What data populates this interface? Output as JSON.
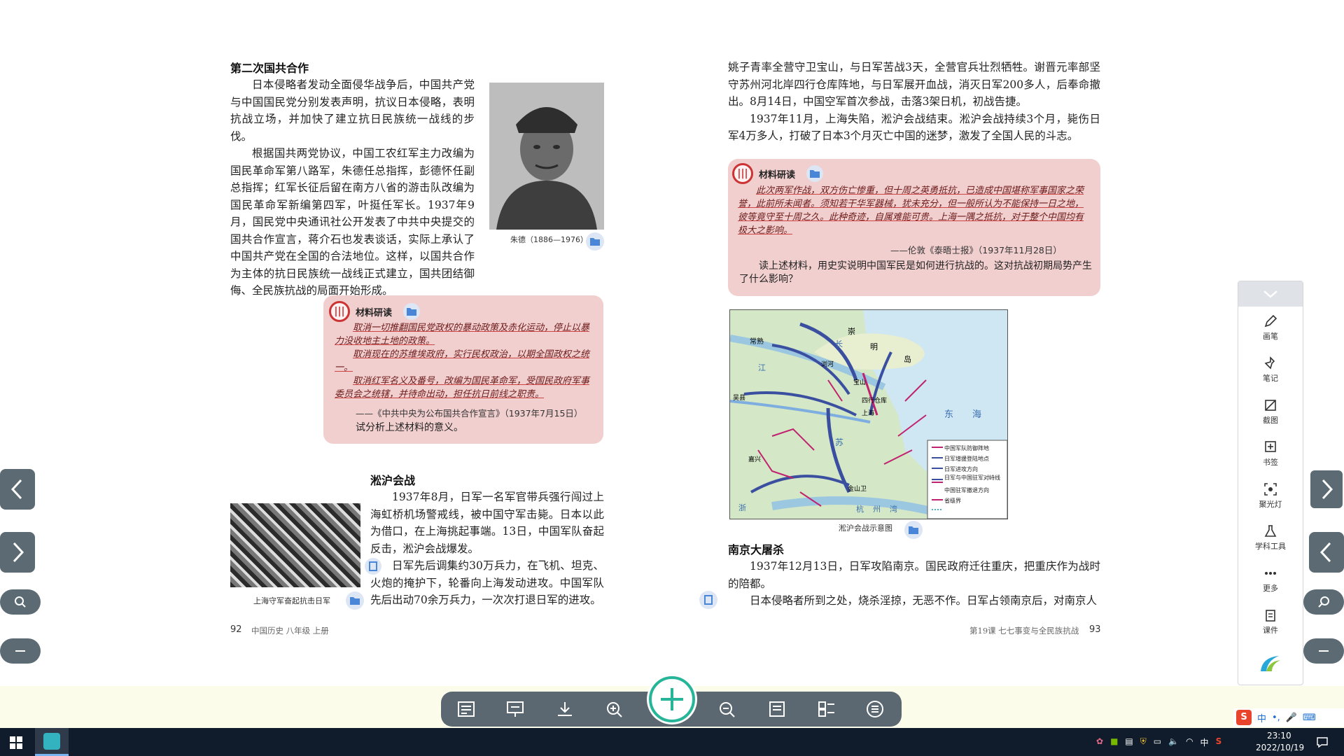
{
  "left_page": {
    "section1_title": "第二次国共合作",
    "para1": "日本侵略者发动全面侵华战争后，中国共产党与中国国民党分别发表声明，抗议日本侵略，表明抗战立场，并加快了建立抗日民族统一战线的步伐。",
    "para2": "根据国共两党协议，中国工农红军主力改编为国民革命军第八路军，朱德任总指挥，彭德怀任副总指挥；红军长征后留在南方八省的游击队改编为国民革命军新编第四军，叶挺任军长。1937年9月，国民党中央通讯社公开发表了中共中央提交的国共合作宣言，蒋介石也发表谈话，实际上承认了中国共产党在全国的合法地位。这样，以国共合作为主体的抗日民族统一战线正式建立，国共团结御侮、全民族抗战的局面开始形成。",
    "photo1_caption": "朱德（1886—1976）",
    "material1": {
      "label": "材料研读",
      "line1": "取消一切推翻国民党政权的暴动政策及赤化运动，停止以暴力没收地主土地的政策。",
      "line2": "取消现在的苏维埃政府，实行民权政治，以期全国政权之统一。",
      "line3": "取消红军名义及番号，改编为国民革命军，受国民政府军事委员会之统辖，并待命出动，担任抗日前线之职责。",
      "source": "——《中共中央为公布国共合作宣言》（1937年7月15日）",
      "question": "试分析上述材料的意义。"
    },
    "section2_title": "淞沪会战",
    "para3": "1937年8月，日军一名军官带兵强行闯过上海虹桥机场警戒线，被中国守军击毙。日本以此为借口，在上海挑起事端。13日，中国军队奋起反击，淞沪会战爆发。",
    "para4": "日军先后调集约30万兵力，在飞机、坦克、火炮的掩护下，轮番向上海发动进攻。中国军队先后出动70余万兵力，一次次打退日军的进攻。",
    "photo2_caption": "上海守军奋起抗击日军",
    "page_num": "92",
    "footer": "中国历史 八年级 上册"
  },
  "right_page": {
    "para1": "姚子青率全营守卫宝山，与日军苦战3天，全营官兵壮烈牺牲。谢晋元率部坚守苏州河北岸四行仓库阵地，与日军展开血战，消灭日军200多人，后奉命撤出。8月14日，中国空军首次参战，击落3架日机，初战告捷。",
    "para2": "1937年11月，上海失陷，淞沪会战结束。淞沪会战持续3个月，毙伤日军4万多人，打破了日本3个月灭亡中国的迷梦，激发了全国人民的斗志。",
    "material2": {
      "label": "材料研读",
      "text": "此次两军作战，双方伤亡惨重，但十周之英勇抵抗，已造成中国堪称军事国家之荣誉，此前所未闻者。须知若干华军器械，犹未充分，但一般所认为不能保持一日之地，彼等竟守至十周之久。此种奇迹，自属难能可贵。上海一隅之抵抗，对于整个中国均有极大之影响。",
      "source": "——伦敦《泰晤士报》（1937年11月28日）",
      "question": "读上述材料，用史实说明中国军民是如何进行抗战的。这对抗战初期局势产生了什么影响？"
    },
    "map": {
      "caption": "淞沪会战示意图",
      "places": [
        "常熟",
        "崇",
        "明",
        "岛",
        "浏河",
        "宝山",
        "四行仓库",
        "上海",
        "吴县",
        "江",
        "东",
        "海",
        "苏",
        "嘉兴",
        "金山卫",
        "杭",
        "州",
        "湾",
        "浙",
        "江",
        "长"
      ],
      "legend": [
        "中国军队防御阵地",
        "日军增援登陆地点",
        "日军进攻方向",
        "日军与中国驻军对峙线",
        "中国驻军撤退方向",
        "省级界"
      ]
    },
    "section3_title": "南京大屠杀",
    "para3": "1937年12月13日，日军攻陷南京。国民政府迁往重庆，把重庆作为战时的陪都。",
    "para4": "日本侵略者所到之处，烧杀淫掠，无恶不作。日军占领南京后，对南京人",
    "page_num": "93",
    "footer": "第19课 七七事变与全民族抗战"
  },
  "right_toolbar": {
    "items": [
      {
        "label": "画笔",
        "icon": "pen-icon"
      },
      {
        "label": "笔记",
        "icon": "pin-icon"
      },
      {
        "label": "截图",
        "icon": "crop-icon"
      },
      {
        "label": "书签",
        "icon": "bookmark-icon"
      },
      {
        "label": "聚光灯",
        "icon": "spotlight-icon"
      },
      {
        "label": "学科工具",
        "icon": "flask-icon"
      },
      {
        "label": "更多",
        "icon": "more-icon"
      },
      {
        "label": "课件",
        "icon": "courseware-icon"
      }
    ]
  },
  "taskbar": {
    "time": "23:10",
    "date": "2022/10/19",
    "ime": "中"
  },
  "colors": {
    "material_bg": "#f2cfcf",
    "accent_green": "#27b59a",
    "nav_gray": "#5b6a73"
  }
}
